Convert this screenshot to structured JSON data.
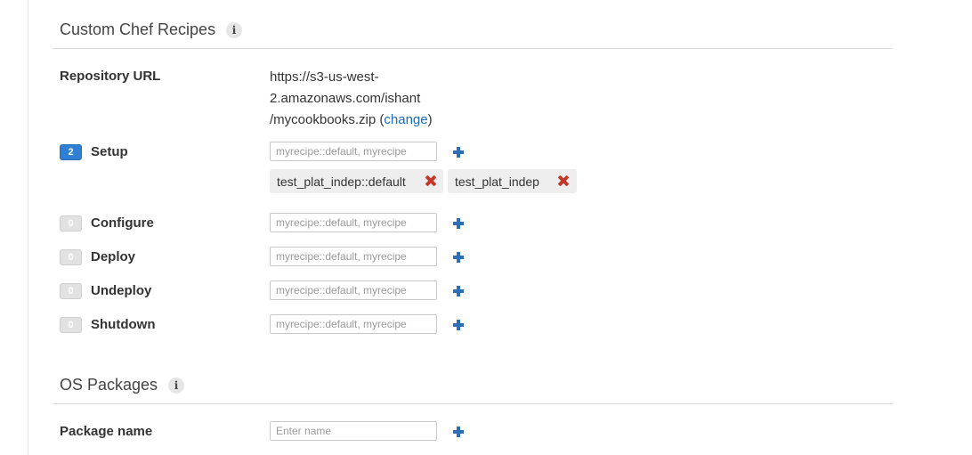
{
  "chef_section": {
    "title": "Custom Chef Recipes",
    "info_icon": "i",
    "repository": {
      "label": "Repository URL",
      "url_line1": "https://s3-us-west-",
      "url_line2": "2.amazonaws.com/ishant",
      "url_line3": "/mycookbooks.zip (",
      "change_link": "change",
      "url_close": ")"
    },
    "events": [
      {
        "label": "Setup",
        "count": "2",
        "placeholder": "myrecipe::default, myrecipe",
        "add_icon": "plus-icon"
      },
      {
        "label": "Configure",
        "count": "0",
        "placeholder": "myrecipe::default, myrecipe",
        "add_icon": "plus-icon"
      },
      {
        "label": "Deploy",
        "count": "0",
        "placeholder": "myrecipe::default, myrecipe",
        "add_icon": "plus-icon"
      },
      {
        "label": "Undeploy",
        "count": "0",
        "placeholder": "myrecipe::default, myrecipe",
        "add_icon": "plus-icon"
      },
      {
        "label": "Shutdown",
        "count": "0",
        "placeholder": "myrecipe::default, myrecipe",
        "add_icon": "plus-icon"
      }
    ],
    "setup_recipes": [
      {
        "name": "test_plat_indep::default",
        "remove_icon": "remove-x-icon"
      },
      {
        "name": "test_plat_indep",
        "remove_icon": "remove-x-icon"
      }
    ]
  },
  "os_section": {
    "title": "OS Packages",
    "info_icon": "i",
    "package_label": "Package name",
    "package_placeholder": "Enter name",
    "add_icon": "plus-icon"
  },
  "colors": {
    "accent_blue": "#2d6fb6",
    "link_blue": "#1a6cbc",
    "active_badge": "#2f7fd2",
    "remove_red": "#c0392b"
  }
}
